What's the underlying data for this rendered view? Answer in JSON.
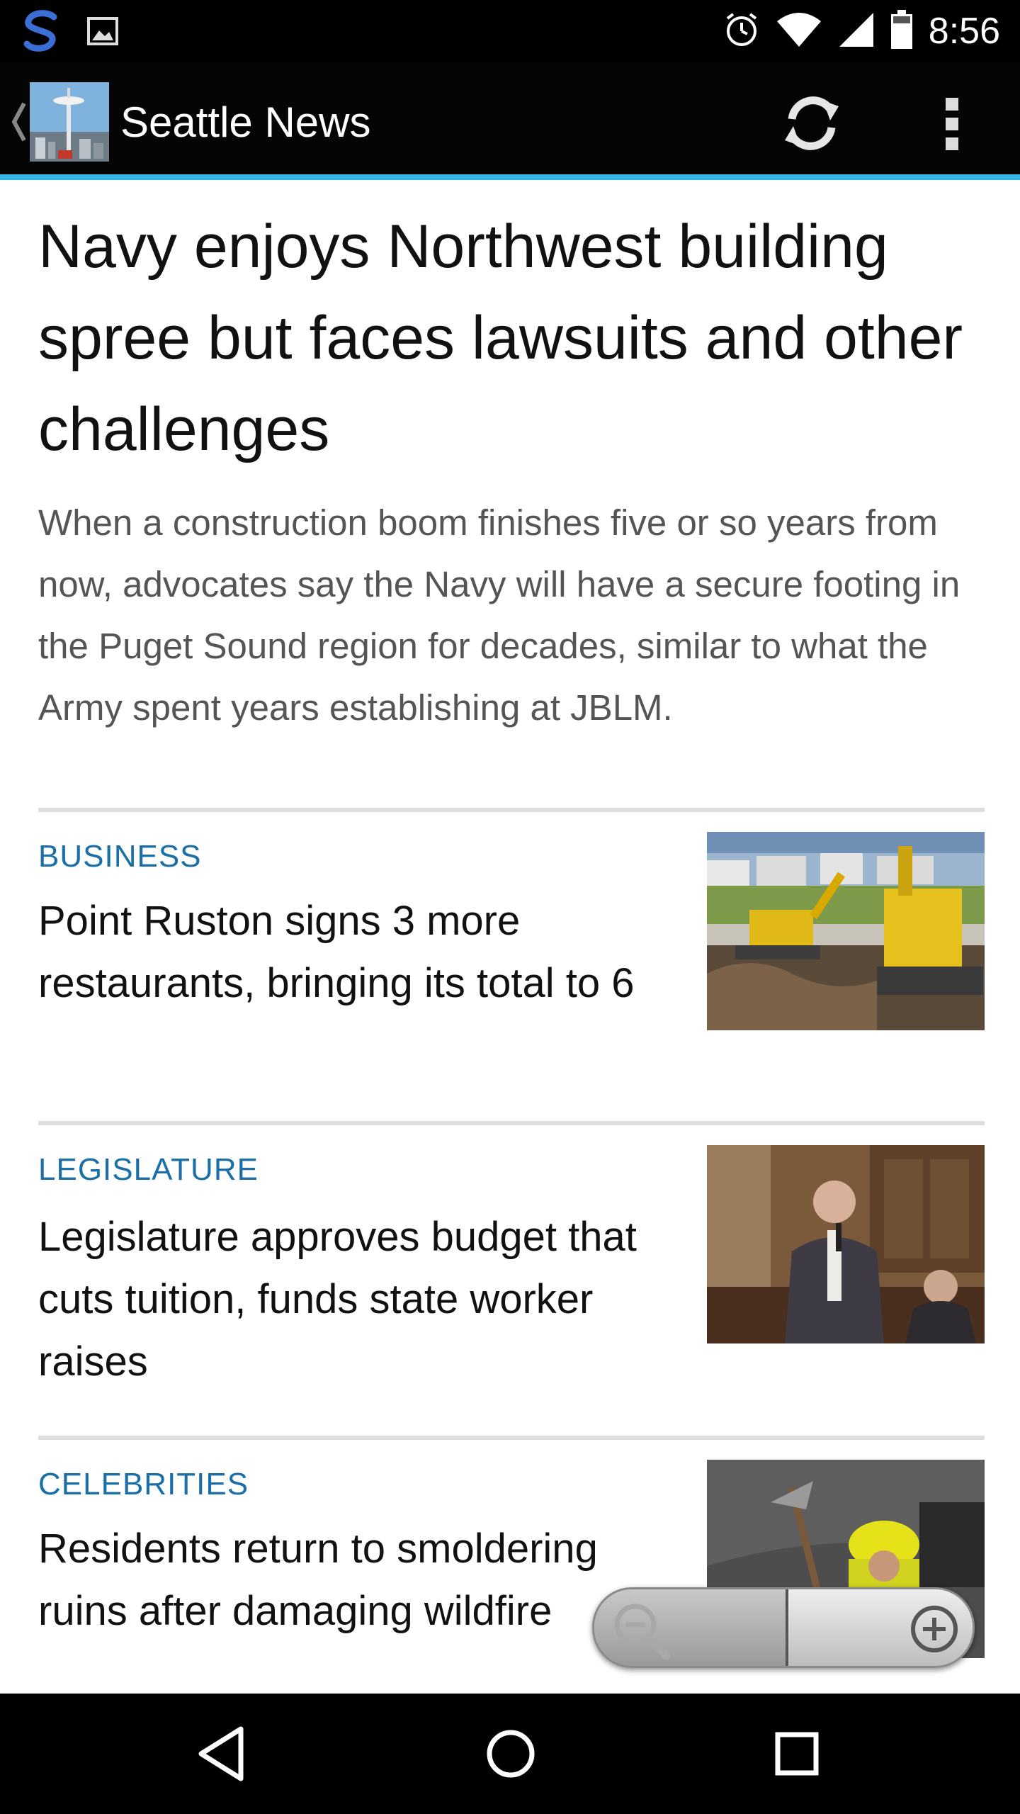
{
  "status_bar": {
    "time": "8:56",
    "icons": [
      "s-app-icon",
      "image-notification-icon",
      "alarm-icon",
      "wifi-icon",
      "signal-icon",
      "battery-icon"
    ]
  },
  "action_bar": {
    "title": "Seattle News",
    "icons": [
      "up-caret-icon",
      "app-logo",
      "refresh-icon",
      "overflow-menu-icon"
    ],
    "accent_color": "#33b5e5"
  },
  "lead_story": {
    "headline": "Navy enjoys Northwest building spree but faces lawsuits and other challenges",
    "summary": "When a construction boom finishes five or so years from now, advocates say the Navy will have a secure footing in the Puget Sound region for decades, similar to what the Army spent years establishing at JBLM."
  },
  "stories": [
    {
      "category": "BUSINESS",
      "title": "Point Ruston signs 3 more restaurants, bringing its total to 6"
    },
    {
      "category": "LEGISLATURE",
      "title": "Legislature approves budget that cuts tuition, funds state worker raises"
    },
    {
      "category": "CELEBRITIES",
      "title": "Residents return to smoldering ruins after damaging wildfire"
    }
  ],
  "category_color": "#1a6fa8",
  "zoom_control": {
    "icons": [
      "zoom-out-icon",
      "zoom-in-icon"
    ]
  },
  "nav_bar": {
    "icons": [
      "back-icon",
      "home-icon",
      "recents-icon"
    ]
  }
}
